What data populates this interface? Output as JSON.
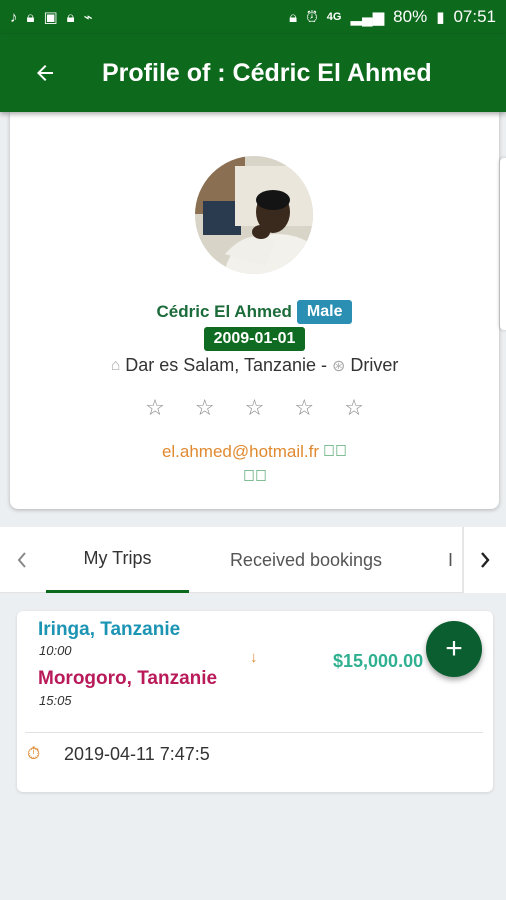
{
  "status_bar": {
    "battery": "80%",
    "time": "07:51",
    "network": "4G",
    "left_icons": [
      "music-note-icon",
      "lock-icon",
      "image-icon",
      "lock-icon",
      "activity-icon"
    ],
    "right_icons": [
      "lock-icon",
      "alarm-icon",
      "signal-icon",
      "battery-icon"
    ]
  },
  "app_bar": {
    "title": "Profile of : Cédric El Ahmed",
    "back_icon": "arrow-back-icon"
  },
  "profile": {
    "name": "Cédric El Ahmed",
    "gender": "Male",
    "dob": "2009-01-01",
    "location": "Dar es Salam, Tanzanie -",
    "role": "Driver",
    "rating_stars": 5,
    "rating_value": 0,
    "email": "el.ahmed@hotmail.fr"
  },
  "tabs": {
    "items": [
      {
        "label": "My Trips",
        "active": true
      },
      {
        "label": "Received bookings",
        "active": false
      },
      {
        "label": "I",
        "active": false
      }
    ]
  },
  "trip": {
    "from": "Iringa, Tanzanie",
    "from_time": "10:00",
    "to": "Morogoro, Tanzanie",
    "to_time": "15:05",
    "price": "$15,000.00",
    "date": "2019-04-11 7:47:5"
  },
  "colors": {
    "primary": "#0d6a1c",
    "gender_badge": "#2b8fb3",
    "from_city": "#1c94b4",
    "to_city": "#b81a5a",
    "price": "#2fb090",
    "accent": "#e08a30"
  }
}
